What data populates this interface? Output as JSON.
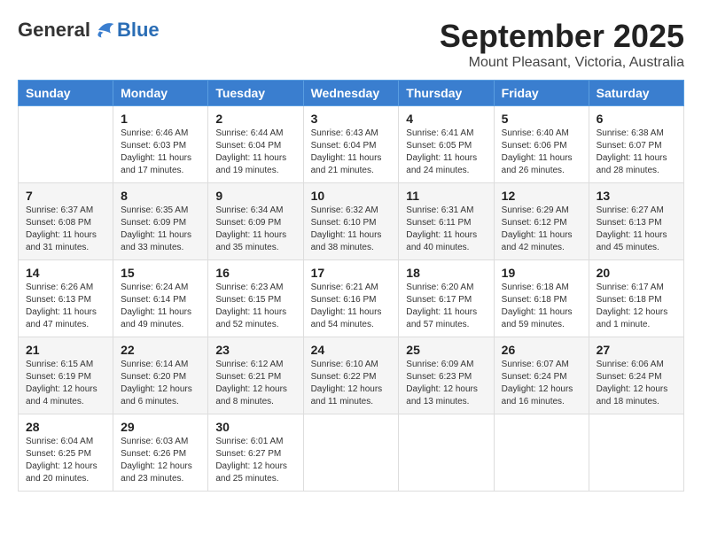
{
  "header": {
    "logo": {
      "general": "General",
      "blue": "Blue"
    },
    "title": "September 2025",
    "location": "Mount Pleasant, Victoria, Australia"
  },
  "calendar": {
    "days_of_week": [
      "Sunday",
      "Monday",
      "Tuesday",
      "Wednesday",
      "Thursday",
      "Friday",
      "Saturday"
    ],
    "weeks": [
      [
        {
          "day": "",
          "info": ""
        },
        {
          "day": "1",
          "info": "Sunrise: 6:46 AM\nSunset: 6:03 PM\nDaylight: 11 hours\nand 17 minutes."
        },
        {
          "day": "2",
          "info": "Sunrise: 6:44 AM\nSunset: 6:04 PM\nDaylight: 11 hours\nand 19 minutes."
        },
        {
          "day": "3",
          "info": "Sunrise: 6:43 AM\nSunset: 6:04 PM\nDaylight: 11 hours\nand 21 minutes."
        },
        {
          "day": "4",
          "info": "Sunrise: 6:41 AM\nSunset: 6:05 PM\nDaylight: 11 hours\nand 24 minutes."
        },
        {
          "day": "5",
          "info": "Sunrise: 6:40 AM\nSunset: 6:06 PM\nDaylight: 11 hours\nand 26 minutes."
        },
        {
          "day": "6",
          "info": "Sunrise: 6:38 AM\nSunset: 6:07 PM\nDaylight: 11 hours\nand 28 minutes."
        }
      ],
      [
        {
          "day": "7",
          "info": "Sunrise: 6:37 AM\nSunset: 6:08 PM\nDaylight: 11 hours\nand 31 minutes."
        },
        {
          "day": "8",
          "info": "Sunrise: 6:35 AM\nSunset: 6:09 PM\nDaylight: 11 hours\nand 33 minutes."
        },
        {
          "day": "9",
          "info": "Sunrise: 6:34 AM\nSunset: 6:09 PM\nDaylight: 11 hours\nand 35 minutes."
        },
        {
          "day": "10",
          "info": "Sunrise: 6:32 AM\nSunset: 6:10 PM\nDaylight: 11 hours\nand 38 minutes."
        },
        {
          "day": "11",
          "info": "Sunrise: 6:31 AM\nSunset: 6:11 PM\nDaylight: 11 hours\nand 40 minutes."
        },
        {
          "day": "12",
          "info": "Sunrise: 6:29 AM\nSunset: 6:12 PM\nDaylight: 11 hours\nand 42 minutes."
        },
        {
          "day": "13",
          "info": "Sunrise: 6:27 AM\nSunset: 6:13 PM\nDaylight: 11 hours\nand 45 minutes."
        }
      ],
      [
        {
          "day": "14",
          "info": "Sunrise: 6:26 AM\nSunset: 6:13 PM\nDaylight: 11 hours\nand 47 minutes."
        },
        {
          "day": "15",
          "info": "Sunrise: 6:24 AM\nSunset: 6:14 PM\nDaylight: 11 hours\nand 49 minutes."
        },
        {
          "day": "16",
          "info": "Sunrise: 6:23 AM\nSunset: 6:15 PM\nDaylight: 11 hours\nand 52 minutes."
        },
        {
          "day": "17",
          "info": "Sunrise: 6:21 AM\nSunset: 6:16 PM\nDaylight: 11 hours\nand 54 minutes."
        },
        {
          "day": "18",
          "info": "Sunrise: 6:20 AM\nSunset: 6:17 PM\nDaylight: 11 hours\nand 57 minutes."
        },
        {
          "day": "19",
          "info": "Sunrise: 6:18 AM\nSunset: 6:18 PM\nDaylight: 11 hours\nand 59 minutes."
        },
        {
          "day": "20",
          "info": "Sunrise: 6:17 AM\nSunset: 6:18 PM\nDaylight: 12 hours\nand 1 minute."
        }
      ],
      [
        {
          "day": "21",
          "info": "Sunrise: 6:15 AM\nSunset: 6:19 PM\nDaylight: 12 hours\nand 4 minutes."
        },
        {
          "day": "22",
          "info": "Sunrise: 6:14 AM\nSunset: 6:20 PM\nDaylight: 12 hours\nand 6 minutes."
        },
        {
          "day": "23",
          "info": "Sunrise: 6:12 AM\nSunset: 6:21 PM\nDaylight: 12 hours\nand 8 minutes."
        },
        {
          "day": "24",
          "info": "Sunrise: 6:10 AM\nSunset: 6:22 PM\nDaylight: 12 hours\nand 11 minutes."
        },
        {
          "day": "25",
          "info": "Sunrise: 6:09 AM\nSunset: 6:23 PM\nDaylight: 12 hours\nand 13 minutes."
        },
        {
          "day": "26",
          "info": "Sunrise: 6:07 AM\nSunset: 6:24 PM\nDaylight: 12 hours\nand 16 minutes."
        },
        {
          "day": "27",
          "info": "Sunrise: 6:06 AM\nSunset: 6:24 PM\nDaylight: 12 hours\nand 18 minutes."
        }
      ],
      [
        {
          "day": "28",
          "info": "Sunrise: 6:04 AM\nSunset: 6:25 PM\nDaylight: 12 hours\nand 20 minutes."
        },
        {
          "day": "29",
          "info": "Sunrise: 6:03 AM\nSunset: 6:26 PM\nDaylight: 12 hours\nand 23 minutes."
        },
        {
          "day": "30",
          "info": "Sunrise: 6:01 AM\nSunset: 6:27 PM\nDaylight: 12 hours\nand 25 minutes."
        },
        {
          "day": "",
          "info": ""
        },
        {
          "day": "",
          "info": ""
        },
        {
          "day": "",
          "info": ""
        },
        {
          "day": "",
          "info": ""
        }
      ]
    ]
  }
}
